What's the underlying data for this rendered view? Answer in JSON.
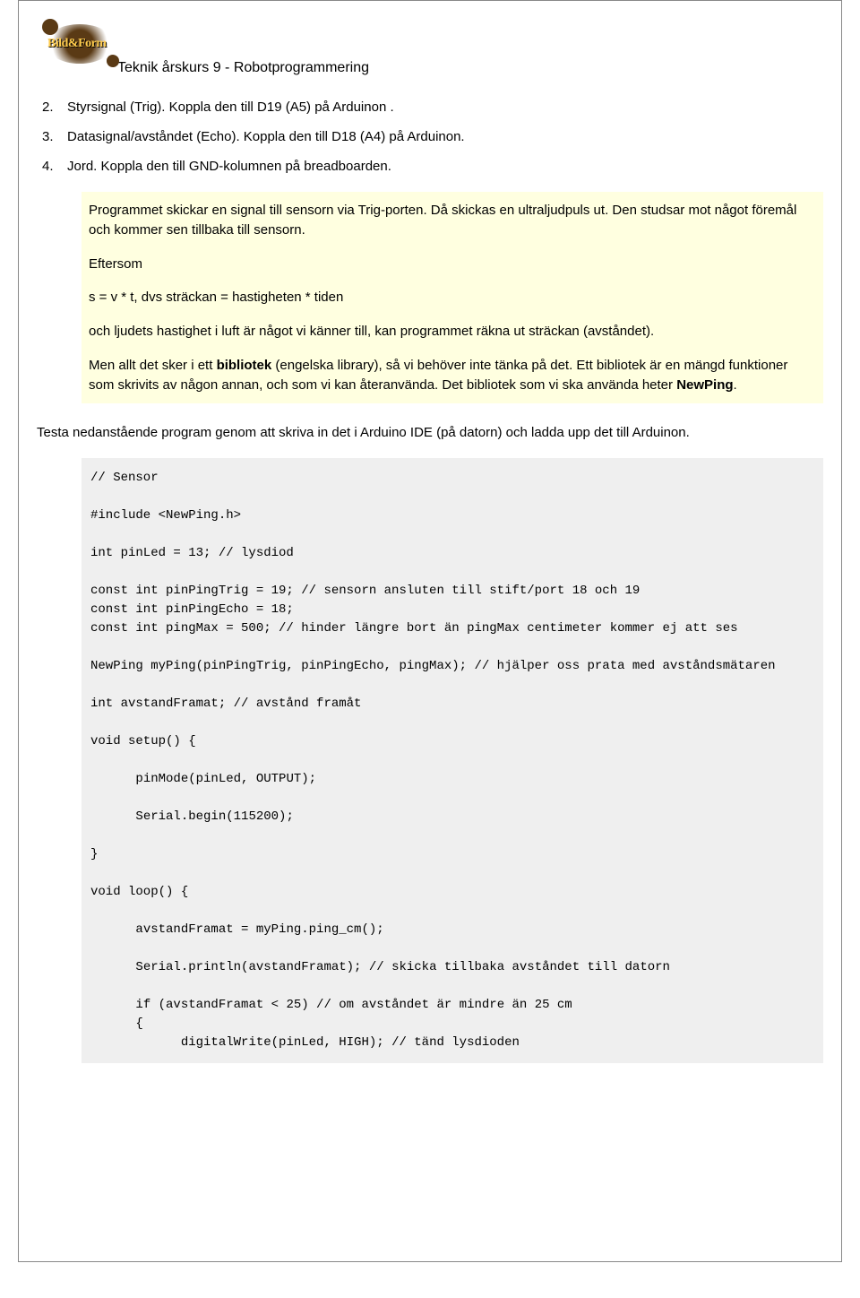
{
  "logo": {
    "text": "Bild&Form"
  },
  "doc_title": "Teknik årskurs 9 - Robotprogrammering",
  "list": {
    "items": [
      {
        "num": "2.",
        "text": "Styrsignal (Trig). Koppla den till D19 (A5) på Arduinon ."
      },
      {
        "num": "3.",
        "text": "Datasignal/avståndet (Echo). Koppla den till D18 (A4) på Arduinon."
      },
      {
        "num": "4.",
        "text": "Jord. Koppla den till GND-kolumnen på breadboarden."
      }
    ]
  },
  "info": {
    "p1": "Programmet skickar en signal till sensorn via Trig-porten. Då skickas en ultraljudpuls ut. Den studsar mot något föremål och kommer sen tillbaka till sensorn.",
    "p2": "Eftersom",
    "p3": "s = v * t, dvs sträckan = hastigheten * tiden",
    "p4": "och ljudets hastighet i luft är något vi känner till, kan programmet räkna ut sträckan (avståndet).",
    "p5_a": "Men allt det sker i ett ",
    "p5_b_bold": "bibliotek",
    "p5_c": " (engelska library), så vi behöver inte tänka på det. Ett bibliotek är en mängd funktioner som skrivits av någon annan, och som vi kan återanvända. Det bibliotek som vi ska använda heter ",
    "p5_d_bold": "NewPing",
    "p5_e": "."
  },
  "para_test": "Testa nedanstående program genom att skriva in det i Arduino IDE (på datorn) och ladda upp det till Arduinon.",
  "code": "// Sensor\n\n#include <NewPing.h>\n\nint pinLed = 13; // lysdiod\n\nconst int pinPingTrig = 19; // sensorn ansluten till stift/port 18 och 19\nconst int pinPingEcho = 18;\nconst int pingMax = 500; // hinder längre bort än pingMax centimeter kommer ej att ses\n\nNewPing myPing(pinPingTrig, pinPingEcho, pingMax); // hjälper oss prata med avståndsmätaren\n\nint avstandFramat; // avstånd framåt\n\nvoid setup() {\n\n      pinMode(pinLed, OUTPUT);\n\n      Serial.begin(115200);\n\n}\n\nvoid loop() {\n\n      avstandFramat = myPing.ping_cm();\n\n      Serial.println(avstandFramat); // skicka tillbaka avståndet till datorn\n\n      if (avstandFramat < 25) // om avståndet är mindre än 25 cm\n      {\n            digitalWrite(pinLed, HIGH); // tänd lysdioden"
}
